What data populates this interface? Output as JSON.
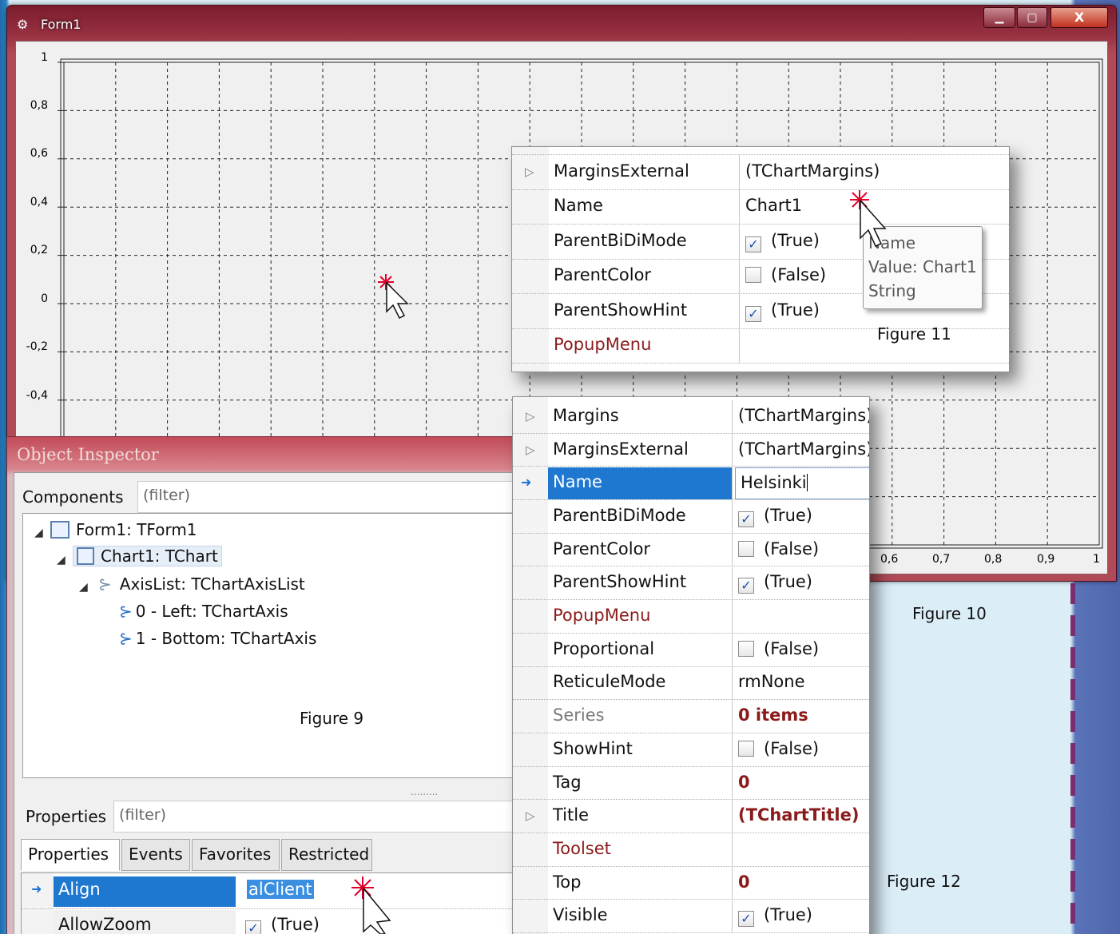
{
  "form1": {
    "title": "Form1",
    "icon": "form-icon",
    "controls": {
      "minimize": "▁",
      "maximize": "▢",
      "close": "X"
    },
    "chart": {
      "y_ticks": [
        "1",
        "0,8",
        "0,6",
        "0,4",
        "0,2",
        "0",
        "-0,2",
        "-0,4"
      ],
      "x_ticks": [
        "0,6",
        "0,7",
        "0,8",
        "0,9",
        "1"
      ]
    }
  },
  "chart_data": {
    "type": "line",
    "series": [],
    "ylim": [
      -0.4,
      1
    ],
    "xlim": [
      0.6,
      1
    ],
    "y_ticks": [
      1,
      0.8,
      0.6,
      0.4,
      0.2,
      0,
      -0.2,
      -0.4
    ],
    "x_ticks": [
      0.6,
      0.7,
      0.8,
      0.9,
      1
    ],
    "grid": true
  },
  "captions": {
    "fig9": "Figure 9",
    "fig10": "Figure 10",
    "fig11": "Figure 11",
    "fig12": "Figure 12"
  },
  "figure11": {
    "rows": [
      {
        "name": "MarginsExternal",
        "value": "(TChartMargins)",
        "expandable": true
      },
      {
        "name": "Name",
        "value": "Chart1"
      },
      {
        "name": "ParentBiDiMode",
        "value": "(True)",
        "checkbox": true,
        "checked": true
      },
      {
        "name": "ParentColor",
        "value": "(False)",
        "checkbox": true,
        "checked": false
      },
      {
        "name": "ParentShowHint",
        "value": "(True)",
        "checkbox": true,
        "checked": true
      },
      {
        "name": "PopupMenu",
        "value": "",
        "red": true
      }
    ],
    "tooltip": {
      "line1": "Name",
      "line2": "Value: Chart1",
      "line3": "String"
    }
  },
  "figure12": {
    "rows": [
      {
        "name": "Margins",
        "value": "(TChartMargins)",
        "expandable": true
      },
      {
        "name": "MarginsExternal",
        "value": "(TChartMargins)",
        "expandable": true
      },
      {
        "name": "Name",
        "value": "Helsinki",
        "selected": true
      },
      {
        "name": "ParentBiDiMode",
        "value": "(True)",
        "checkbox": true,
        "checked": true
      },
      {
        "name": "ParentColor",
        "value": "(False)",
        "checkbox": true,
        "checked": false
      },
      {
        "name": "ParentShowHint",
        "value": "(True)",
        "checkbox": true,
        "checked": true
      },
      {
        "name": "PopupMenu",
        "value": "",
        "red": true
      },
      {
        "name": "Proportional",
        "value": "(False)",
        "checkbox": true,
        "checked": false
      },
      {
        "name": "ReticuleMode",
        "value": "rmNone"
      },
      {
        "name": "Series",
        "value": "0 items",
        "gray": true,
        "boldred": true
      },
      {
        "name": "ShowHint",
        "value": "(False)",
        "checkbox": true,
        "checked": false
      },
      {
        "name": "Tag",
        "value": "0",
        "boldred": true
      },
      {
        "name": "Title",
        "value": "(TChartTitle)",
        "expandable": true,
        "boldred": true
      },
      {
        "name": "Toolset",
        "value": "",
        "red": true
      },
      {
        "name": "Top",
        "value": "0",
        "boldred": true
      },
      {
        "name": "Visible",
        "value": "(True)",
        "checkbox": true,
        "checked": true
      }
    ]
  },
  "object_inspector": {
    "title": "Object Inspector",
    "components_label": "Components",
    "components_filter_placeholder": "(filter)",
    "tree": [
      {
        "label": "Form1: TForm1",
        "level": 0
      },
      {
        "label": "Chart1: TChart",
        "level": 1,
        "selected": true
      },
      {
        "label": "AxisList: TChartAxisList",
        "level": 2
      },
      {
        "label": "0 - Left: TChartAxis",
        "level": 3
      },
      {
        "label": "1 - Bottom: TChartAxis",
        "level": 3
      }
    ],
    "properties_label": "Properties",
    "properties_filter_placeholder": "(filter)",
    "tabs": [
      "Properties",
      "Events",
      "Favorites",
      "Restricted"
    ],
    "active_tab": "Properties",
    "rows": [
      {
        "name": "Align",
        "value": "alClient",
        "selected": true
      },
      {
        "name": "AllowZoom",
        "value": "(True)",
        "checkbox": true,
        "checked": true
      }
    ]
  }
}
